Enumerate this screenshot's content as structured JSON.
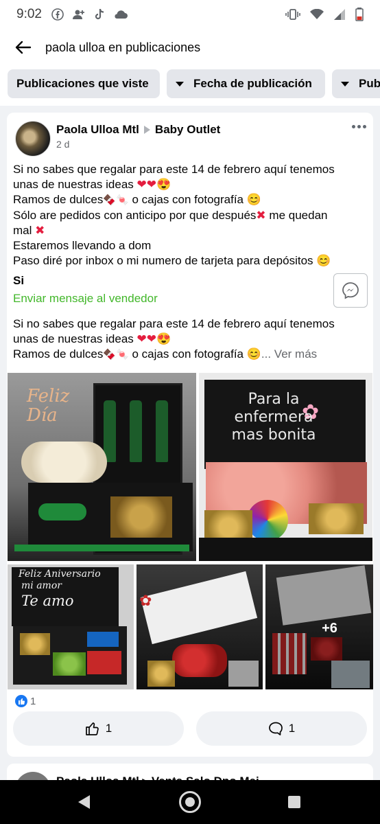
{
  "status_bar": {
    "time": "9:02"
  },
  "search": {
    "query": "paola ulloa en publicaciones"
  },
  "filters": [
    {
      "label": "Publicaciones que viste"
    },
    {
      "label": "Fecha de publicación"
    },
    {
      "label": "Pub"
    }
  ],
  "post": {
    "author": "Paola Ulloa Mtl",
    "group": "Baby Outlet",
    "time": "2 d",
    "text_lines": [
      "Si no sabes que regalar para este 14 de febrero aquí tenemos",
      "unas de nuestras ideas",
      "Ramos de dulces",
      "o cajas con fotografía",
      "Sólo are pedidos con anticipo por que después",
      "me quedan",
      "mal",
      "Estaremos llevando a dom",
      "Paso diré por inbox o mi numero de tarjeta para depósitos"
    ],
    "item_title": "Si",
    "seller_link": "Enviar mensaje al vendedor",
    "preview_lines": [
      "Si no sabes que regalar para este 14 de febrero aquí tenemos",
      "unas de nuestras ideas",
      "Ramos de dulces",
      "o cajas con fotografía"
    ],
    "ver_mas": "... Ver más",
    "photo_captions": {
      "p1": "Feliz Día",
      "p2_lines": [
        "Para la",
        "enfermera",
        "mas bonita"
      ],
      "p3_lines": [
        "Feliz Aniversario",
        "mi amor",
        "Te amo"
      ],
      "p6_more": "+6"
    },
    "reaction_count": "1",
    "like_count": "1",
    "comment_count": "1"
  },
  "next_post": {
    "author_partial": "Paola Ulloa Mtl ▸ Venta Salo Dpo Mei..."
  },
  "colors": {
    "accent_blue": "#1877f2",
    "seller_green": "#42b72a",
    "heart_red": "#e41e3f"
  }
}
